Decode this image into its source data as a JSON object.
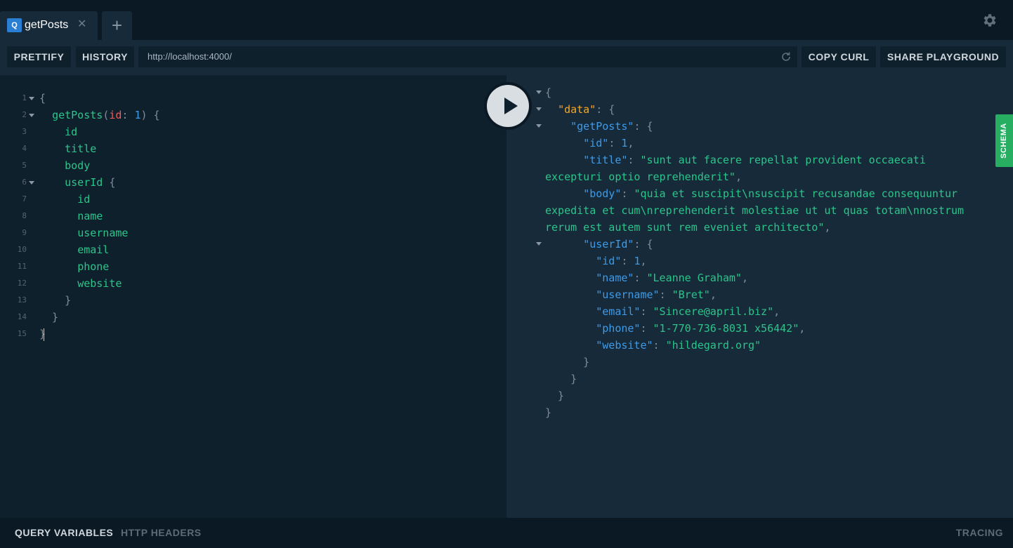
{
  "tab": {
    "badge": "Q",
    "title": "getPosts",
    "close": "✕",
    "new_tab": "+"
  },
  "toolbar": {
    "prettify": "PRETTIFY",
    "history": "HISTORY",
    "url": "http://localhost:4000/",
    "copy_curl": "COPY CURL",
    "share": "SHARE PLAYGROUND"
  },
  "query": {
    "line_numbers": [
      "1",
      "2",
      "3",
      "4",
      "5",
      "6",
      "7",
      "8",
      "9",
      "10",
      "11",
      "12",
      "13",
      "14",
      "15"
    ],
    "op_name": "getPosts",
    "arg_name": "id",
    "arg_value": "1",
    "fields": [
      "id",
      "title",
      "body",
      "userId"
    ],
    "user_fields": [
      "id",
      "name",
      "username",
      "email",
      "phone",
      "website"
    ]
  },
  "result": {
    "data_key": "\"data\"",
    "getposts_key": "\"getPosts\"",
    "id_key": "\"id\"",
    "id_val": "1",
    "title_key": "\"title\"",
    "title_val_1": "\"sunt aut facere repellat provident occaecati",
    "title_val_2": "excepturi optio reprehenderit\"",
    "body_key": "\"body\"",
    "body_val_1": "\"quia et suscipit\\nsuscipit recusandae consequuntur",
    "body_val_2": "expedita et cum\\nreprehenderit molestiae ut ut quas totam\\nnostrum",
    "body_val_3": "rerum est autem sunt rem eveniet architecto\"",
    "userid_key": "\"userId\"",
    "u_id_key": "\"id\"",
    "u_id_val": "1",
    "u_name_key": "\"name\"",
    "u_name_val": "\"Leanne Graham\"",
    "u_username_key": "\"username\"",
    "u_username_val": "\"Bret\"",
    "u_email_key": "\"email\"",
    "u_email_val": "\"Sincere@april.biz\"",
    "u_phone_key": "\"phone\"",
    "u_phone_val": "\"1-770-736-8031 x56442\"",
    "u_website_key": "\"website\"",
    "u_website_val": "\"hildegard.org\""
  },
  "schema_tab": "SCHEMA",
  "bottom": {
    "query_variables": "QUERY VARIABLES",
    "http_headers": "HTTP HEADERS",
    "tracing": "TRACING"
  },
  "icons": {
    "settings": "gear-icon",
    "run": "play-icon",
    "reload": "reload-icon"
  }
}
